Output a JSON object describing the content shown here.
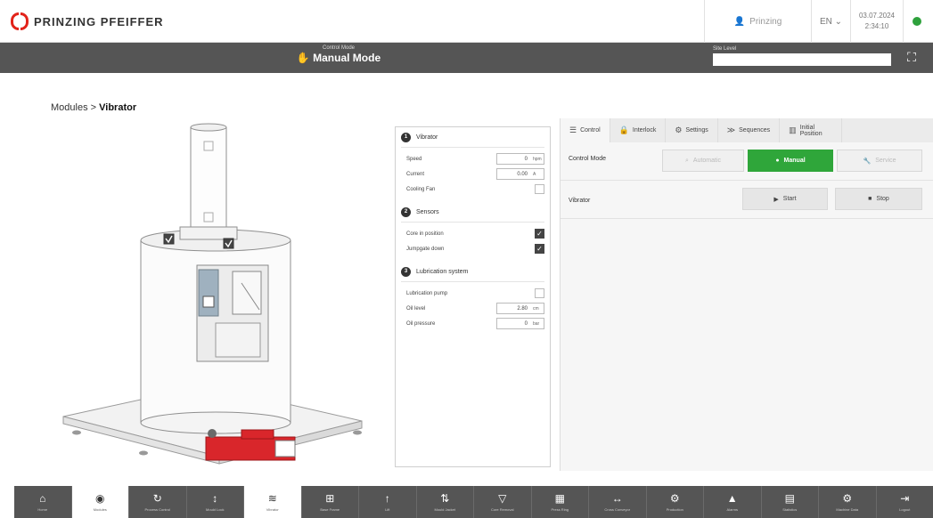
{
  "header": {
    "brand": "PRINZING PFEIFFER",
    "user": "Prinzing",
    "language": "EN",
    "date": "03.07.2024",
    "time": "2:34:10",
    "status_color": "#2ea13c"
  },
  "modebar": {
    "mode_label": "Control Mode",
    "mode_value": "Manual Mode",
    "site_level_label": "Site Level"
  },
  "breadcrumb": {
    "parent": "Modules",
    "separator": ">",
    "current": "Vibrator"
  },
  "midpanel": {
    "sections": [
      {
        "num": "1",
        "title": "Vibrator",
        "rows": [
          {
            "label": "Speed",
            "kind": "value",
            "value": "0",
            "unit": "hpm"
          },
          {
            "label": "Current",
            "kind": "value",
            "value": "0.00",
            "unit": "A"
          },
          {
            "label": "Cooling Fan",
            "kind": "check",
            "checked": false
          }
        ]
      },
      {
        "num": "2",
        "title": "Sensors",
        "rows": [
          {
            "label": "Core in position",
            "kind": "check",
            "checked": true
          },
          {
            "label": "Jumpgate down",
            "kind": "check",
            "checked": true
          }
        ]
      },
      {
        "num": "3",
        "title": "Lubrication system",
        "rows": [
          {
            "label": "Lubrication pump",
            "kind": "check",
            "checked": false
          },
          {
            "label": "Oil level",
            "kind": "value",
            "value": "2.80",
            "unit": "cm"
          },
          {
            "label": "Oil pressure",
            "kind": "value",
            "value": "0",
            "unit": "bar"
          }
        ]
      }
    ]
  },
  "rightpanel": {
    "tabs": [
      {
        "label": "Control",
        "icon": "sliders-icon",
        "glyph": "☰"
      },
      {
        "label": "Interlock",
        "icon": "lock-icon",
        "glyph": "🔒"
      },
      {
        "label": "Settings",
        "icon": "gears-icon",
        "glyph": "⚙"
      },
      {
        "label": "Sequences",
        "icon": "sequences-icon",
        "glyph": "≫"
      },
      {
        "label": "Initial Position",
        "icon": "chart-icon",
        "glyph": "▥"
      }
    ],
    "control_mode_label": "Control Mode",
    "mode_buttons": {
      "automatic": "Automatic",
      "manual": "Manual",
      "service": "Service"
    },
    "vibrator_label": "Vibrator",
    "vibrator_buttons": {
      "start": "Start",
      "stop": "Stop"
    },
    "accent_green": "#2fa63a"
  },
  "toolbar": {
    "buttons": [
      {
        "label": "Home",
        "icon": "home-icon",
        "glyph": "⌂"
      },
      {
        "label": "Modules",
        "icon": "modules-icon",
        "glyph": "◉"
      },
      {
        "label": "Process Control",
        "icon": "refresh-icon",
        "glyph": "↻"
      },
      {
        "label": "Mould Lock",
        "icon": "updown-icon",
        "glyph": "↕"
      },
      {
        "label": "Vibrator",
        "icon": "vibrator-icon",
        "glyph": "≋"
      },
      {
        "label": "Base Frame",
        "icon": "frame-icon",
        "glyph": "⊞"
      },
      {
        "label": "Lift",
        "icon": "lift-icon",
        "glyph": "↑"
      },
      {
        "label": "Mould Jacket",
        "icon": "jacket-icon",
        "glyph": "⇅"
      },
      {
        "label": "Core Removal",
        "icon": "bin-icon",
        "glyph": "▽"
      },
      {
        "label": "Press Ring",
        "icon": "ring-icon",
        "glyph": "▦"
      },
      {
        "label": "Cross Conveyor",
        "icon": "conveyor-icon",
        "glyph": "↔"
      },
      {
        "label": "Production",
        "icon": "gear-icon",
        "glyph": "⚙"
      },
      {
        "label": "Alarms",
        "icon": "alarm-icon",
        "glyph": "▲"
      },
      {
        "label": "Statistics",
        "icon": "stats-icon",
        "glyph": "▤"
      },
      {
        "label": "Machine Data",
        "icon": "data-icon",
        "glyph": "⚙"
      },
      {
        "label": "Logout",
        "icon": "logout-icon",
        "glyph": "⇥"
      }
    ]
  }
}
